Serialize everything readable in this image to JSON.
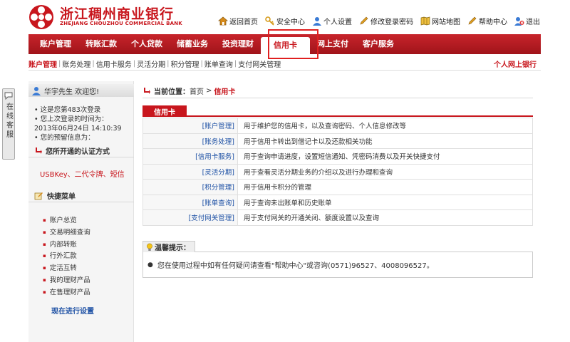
{
  "bank": {
    "name_cn": "浙江稠州商业银行",
    "name_en": "ZHEJIANG CHOUZHOU COMMERCIAL BANK",
    "brand_color": "#c8161d"
  },
  "toplinks": [
    {
      "label": "返回首页",
      "icon": "home-icon"
    },
    {
      "label": "安全中心",
      "icon": "key-icon"
    },
    {
      "label": "个人设置",
      "icon": "user-icon"
    },
    {
      "label": "修改登录密码",
      "icon": "pencil-icon"
    },
    {
      "label": "网站地图",
      "icon": "map-icon"
    },
    {
      "label": "帮助中心",
      "icon": "help-icon"
    },
    {
      "label": "退出",
      "icon": "exit-icon"
    }
  ],
  "nav": [
    {
      "label": "账户管理"
    },
    {
      "label": "转账汇款"
    },
    {
      "label": "个人贷款"
    },
    {
      "label": "储蓄业务"
    },
    {
      "label": "投资理财"
    },
    {
      "label": "信用卡"
    },
    {
      "label": "网上支付"
    },
    {
      "label": "客户服务"
    }
  ],
  "subnav": {
    "items": [
      "账户管理",
      "账务处理",
      "信用卡服务",
      "灵活分期",
      "积分管理",
      "账单查询",
      "支付网关管理"
    ],
    "right": "个人网上银行"
  },
  "float_tab": {
    "label": "在线客服"
  },
  "sidebar": {
    "welcome": "华宇先生 欢迎您!",
    "info": [
      "• 这是您第483次登录",
      "• 您上次登录的时间为：",
      "2013年06月24日 14:10:39",
      "• 您的预留信息为："
    ],
    "auth_title": "您所开通的认证方式",
    "auth_methods": "USBKey、二代令牌、短信",
    "quick_title": "快捷菜单",
    "quick_menu": [
      "账户总览",
      "交易明细查询",
      "内部转账",
      "行外汇款",
      "定活互转",
      "我的理财产品",
      "在售理财产品"
    ],
    "setup_link": "现在进行设置"
  },
  "breadcrumb": {
    "label": "当前位置：",
    "home": "首页",
    "sep": ">",
    "current": "信用卡"
  },
  "section_tab": "信用卡",
  "rows": [
    {
      "link": "[账户管理]",
      "desc": "用于维护您的信用卡，以及查询密码、个人信息修改等"
    },
    {
      "link": "[账务处理]",
      "desc": "用于信用卡转出到借记卡以及还款相关功能"
    },
    {
      "link": "[信用卡服务]",
      "desc": "用于查询申请进度，设置短信通知、凭密码消费以及开关快捷支付"
    },
    {
      "link": "[灵活分期]",
      "desc": "用于查看灵活分期业务的介绍以及进行办理和查询"
    },
    {
      "link": "[积分管理]",
      "desc": "用于信用卡积分的管理"
    },
    {
      "link": "[账单查询]",
      "desc": "用于查询未出账单和历史账单"
    },
    {
      "link": "[支付网关管理]",
      "desc": "用于支付网关的开通关闭、额度设置以及查询"
    }
  ],
  "tips": {
    "title": "温馨提示：",
    "text": "您在使用过程中如有任何疑问请查看\"帮助中心\"或咨询(0571)96527、4008096527。"
  }
}
